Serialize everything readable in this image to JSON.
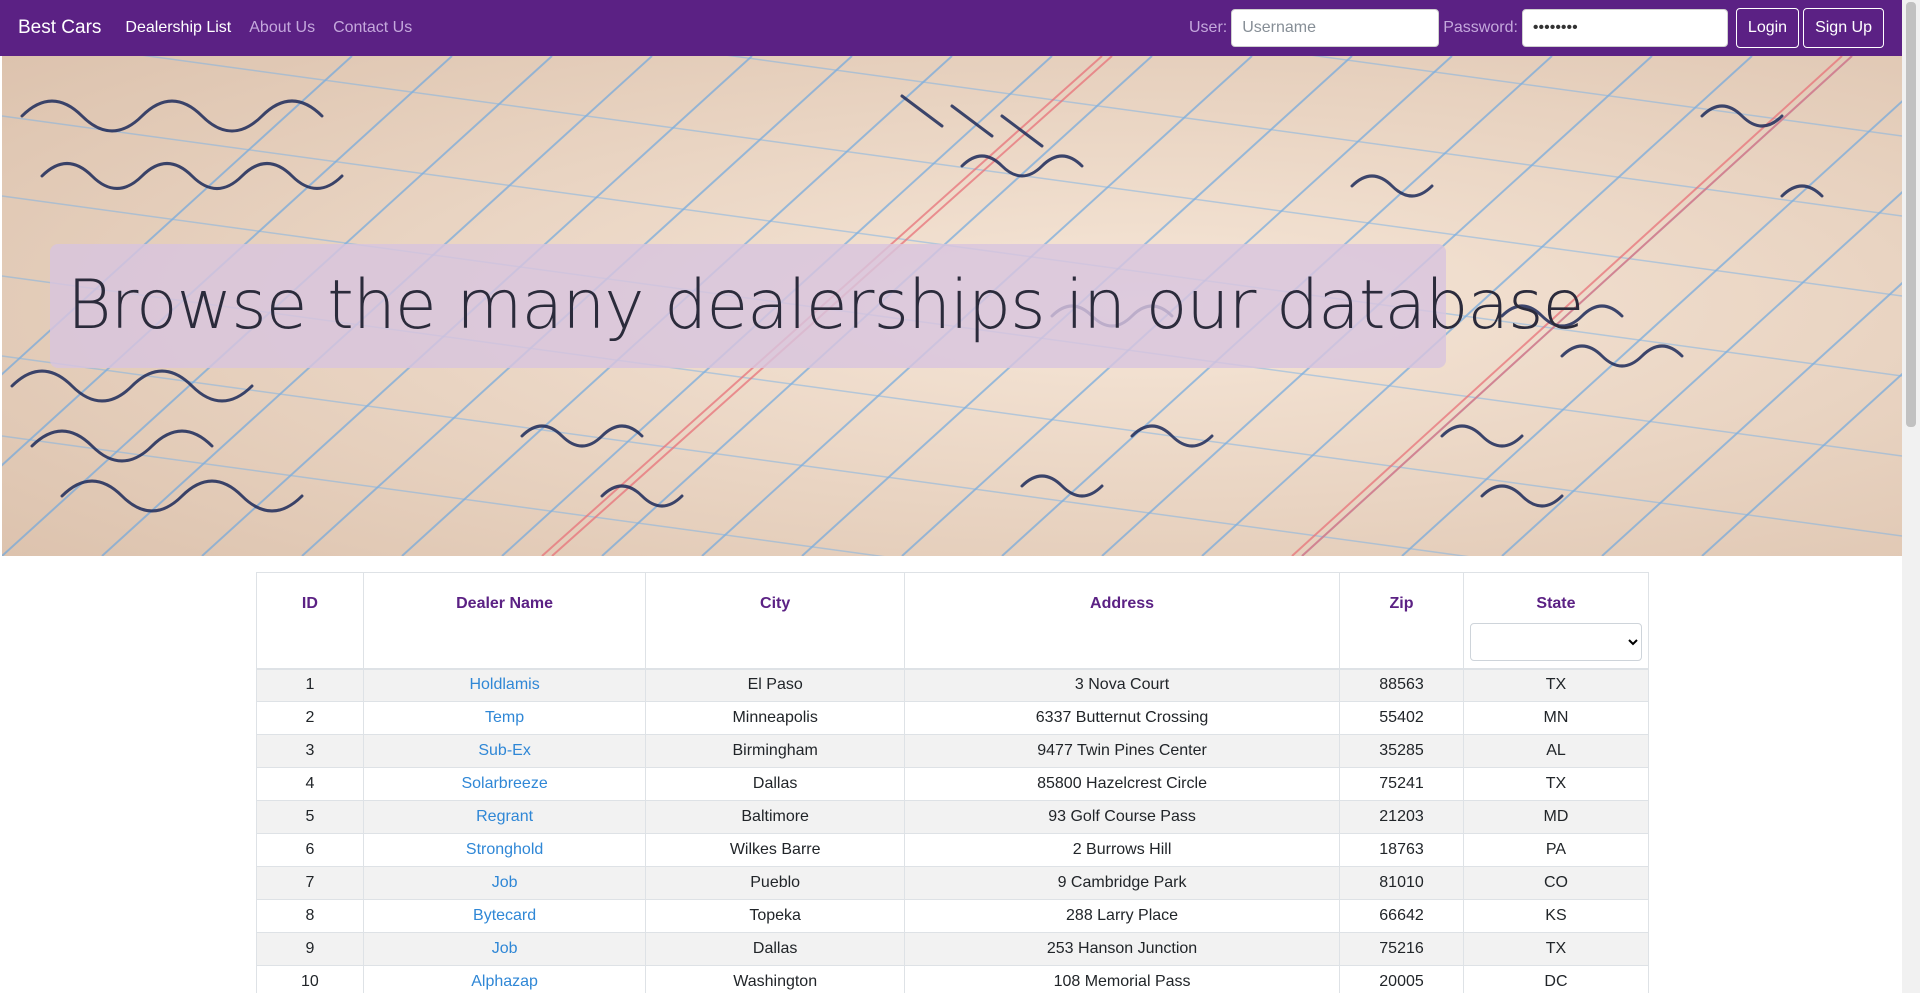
{
  "nav": {
    "brand": "Best Cars",
    "links": [
      {
        "label": "Dealership List",
        "active": true
      },
      {
        "label": "About Us",
        "active": false
      },
      {
        "label": "Contact Us",
        "active": false
      }
    ],
    "user_label": "User:",
    "user_placeholder": "Username",
    "password_label": "Password:",
    "password_value": "********",
    "login_label": "Login",
    "signup_label": "Sign Up"
  },
  "hero": {
    "title": "Browse the many dealerships in our database"
  },
  "table": {
    "headers": [
      "ID",
      "Dealer Name",
      "City",
      "Address",
      "Zip",
      "State"
    ],
    "state_filter_value": "",
    "rows": [
      [
        "1",
        "Holdlamis",
        "El Paso",
        "3 Nova Court",
        "88563",
        "TX"
      ],
      [
        "2",
        "Temp",
        "Minneapolis",
        "6337 Butternut Crossing",
        "55402",
        "MN"
      ],
      [
        "3",
        "Sub-Ex",
        "Birmingham",
        "9477 Twin Pines Center",
        "35285",
        "AL"
      ],
      [
        "4",
        "Solarbreeze",
        "Dallas",
        "85800 Hazelcrest Circle",
        "75241",
        "TX"
      ],
      [
        "5",
        "Regrant",
        "Baltimore",
        "93 Golf Course Pass",
        "21203",
        "MD"
      ],
      [
        "6",
        "Stronghold",
        "Wilkes Barre",
        "2 Burrows Hill",
        "18763",
        "PA"
      ],
      [
        "7",
        "Job",
        "Pueblo",
        "9 Cambridge Park",
        "81010",
        "CO"
      ],
      [
        "8",
        "Bytecard",
        "Topeka",
        "288 Larry Place",
        "66642",
        "KS"
      ],
      [
        "9",
        "Job",
        "Dallas",
        "253 Hanson Junction",
        "75216",
        "TX"
      ],
      [
        "10",
        "Alphazap",
        "Washington",
        "108 Memorial Pass",
        "20005",
        "DC"
      ]
    ]
  },
  "colors": {
    "navbar": "#5b2184",
    "header_text": "#5b2184",
    "link": "#2f87d6"
  }
}
